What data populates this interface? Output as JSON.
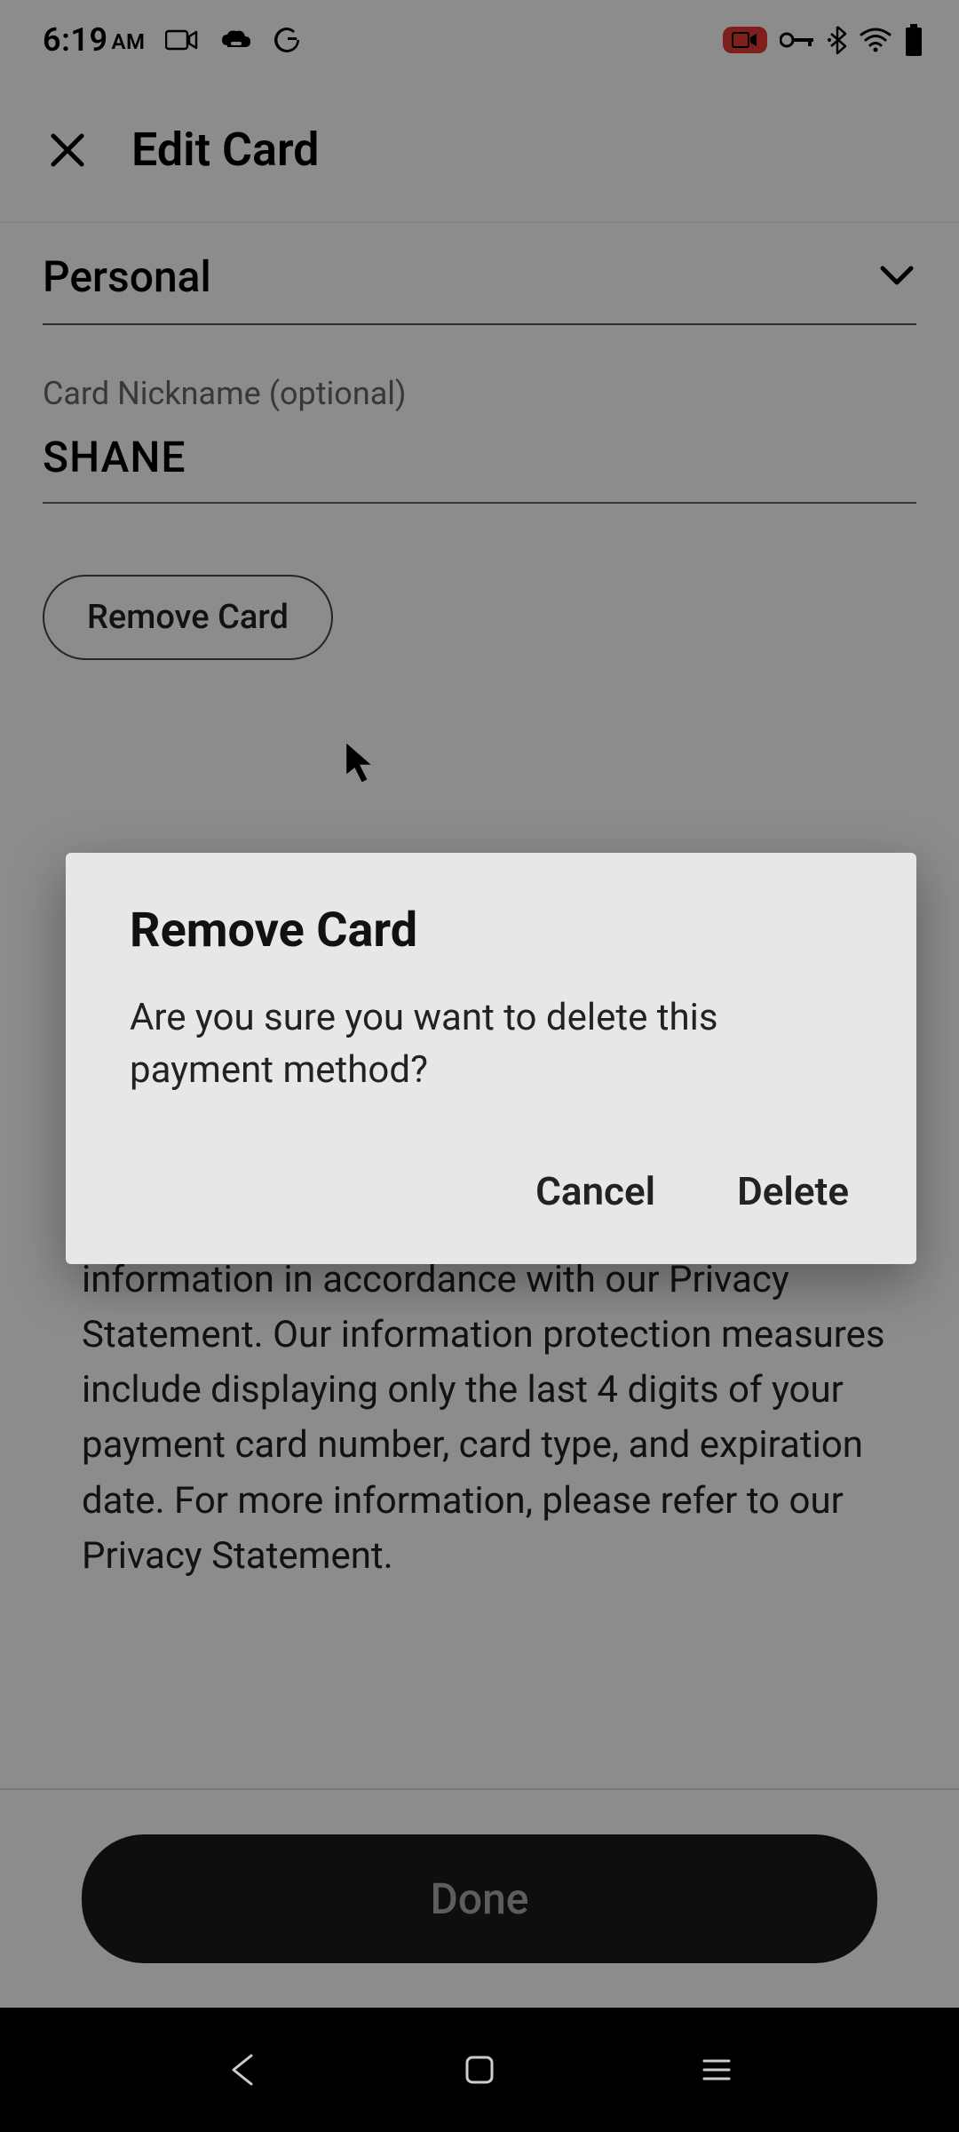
{
  "status_bar": {
    "time": "6:19",
    "ampm": "AM"
  },
  "header": {
    "title": "Edit Card"
  },
  "form": {
    "card_type_value": "Personal",
    "nickname_label": "Card Nickname (optional)",
    "nickname_value": "SHANE",
    "remove_card_label": "Remove Card"
  },
  "dialog": {
    "title": "Remove Card",
    "message": "Are you sure you want to delete this payment method?",
    "cancel_label": "Cancel",
    "delete_label": "Delete"
  },
  "privacy": {
    "text": "information in accordance with our Privacy Statement. Our information protection measures include displaying only the last 4 digits of your payment card number, card type, and expiration date. For more information, please refer to our Privacy Statement."
  },
  "footer": {
    "done_label": "Done"
  }
}
